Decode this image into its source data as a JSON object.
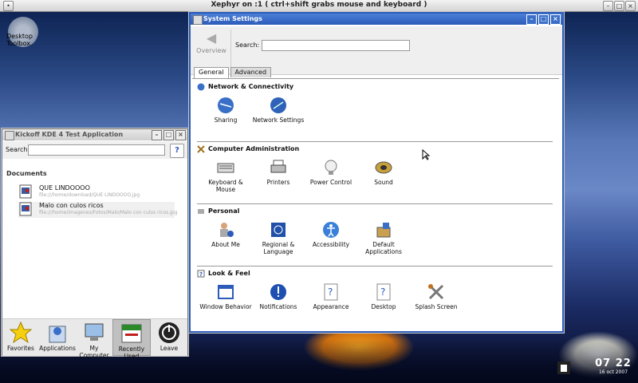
{
  "xephyr": {
    "title": "Xephyr on :1 ( ctrl+shift grabs mouse and keyboard )"
  },
  "desktop": {
    "toolbox_label": "Desktop Toolbox"
  },
  "system_settings": {
    "title": "System Settings",
    "overview_label": "Overview",
    "search_label": "Search:",
    "search_value": "",
    "tabs": [
      {
        "label": "General",
        "active": true
      },
      {
        "label": "Advanced",
        "active": false
      }
    ],
    "sections": [
      {
        "title": "Network & Connectivity",
        "modules": [
          {
            "label": "Sharing",
            "icon": "globe-icon"
          },
          {
            "label": "Network Settings",
            "icon": "network-globe-icon"
          }
        ]
      },
      {
        "title": "Computer Administration",
        "modules": [
          {
            "label": "Keyboard & Mouse",
            "icon": "keyboard-icon"
          },
          {
            "label": "Printers",
            "icon": "printer-icon"
          },
          {
            "label": "Power Control",
            "icon": "lightbulb-icon"
          },
          {
            "label": "Sound",
            "icon": "speaker-icon"
          }
        ]
      },
      {
        "title": "Personal",
        "modules": [
          {
            "label": "About Me",
            "icon": "user-info-icon"
          },
          {
            "label": "Regional & Language",
            "icon": "flag-icon"
          },
          {
            "label": "Accessibility",
            "icon": "accessibility-icon"
          },
          {
            "label": "Default Applications",
            "icon": "default-apps-icon"
          }
        ]
      },
      {
        "title": "Look & Feel",
        "modules": [
          {
            "label": "Window Behavior",
            "icon": "window-behavior-icon"
          },
          {
            "label": "Notifications",
            "icon": "notification-icon"
          },
          {
            "label": "Appearance",
            "icon": "appearance-icon"
          },
          {
            "label": "Desktop",
            "icon": "desktop-icon"
          },
          {
            "label": "Splash Screen",
            "icon": "tools-icon"
          }
        ]
      }
    ]
  },
  "kickoff": {
    "title": "Kickoff KDE 4 Test Application",
    "search_label": "Search:",
    "help_label": "?",
    "section_label": "Documents",
    "documents": [
      {
        "name": "QUE LINDOOOO",
        "path": "file:///home/download/QUE LINDOOOO.jpg"
      },
      {
        "name": "Malo con culos ricos",
        "path": "file:///home/imagenes/Fotos/Malo/Malo con culos ricos.jpg"
      }
    ],
    "tabs": [
      {
        "label": "Favorites",
        "icon": "star-icon",
        "selected": false
      },
      {
        "label": "Applications",
        "icon": "applications-icon",
        "selected": false
      },
      {
        "label": "My Computer",
        "icon": "computer-icon",
        "selected": false
      },
      {
        "label": "Recently Used",
        "icon": "calendar-icon",
        "selected": true
      },
      {
        "label": "Leave",
        "icon": "power-icon",
        "selected": false
      }
    ]
  },
  "panel": {
    "time": "07 22",
    "date": "16 oct 2007"
  },
  "colors": {
    "titlebar_active": "#2c5cb8",
    "desktop_bg": "#3e5aa0"
  }
}
